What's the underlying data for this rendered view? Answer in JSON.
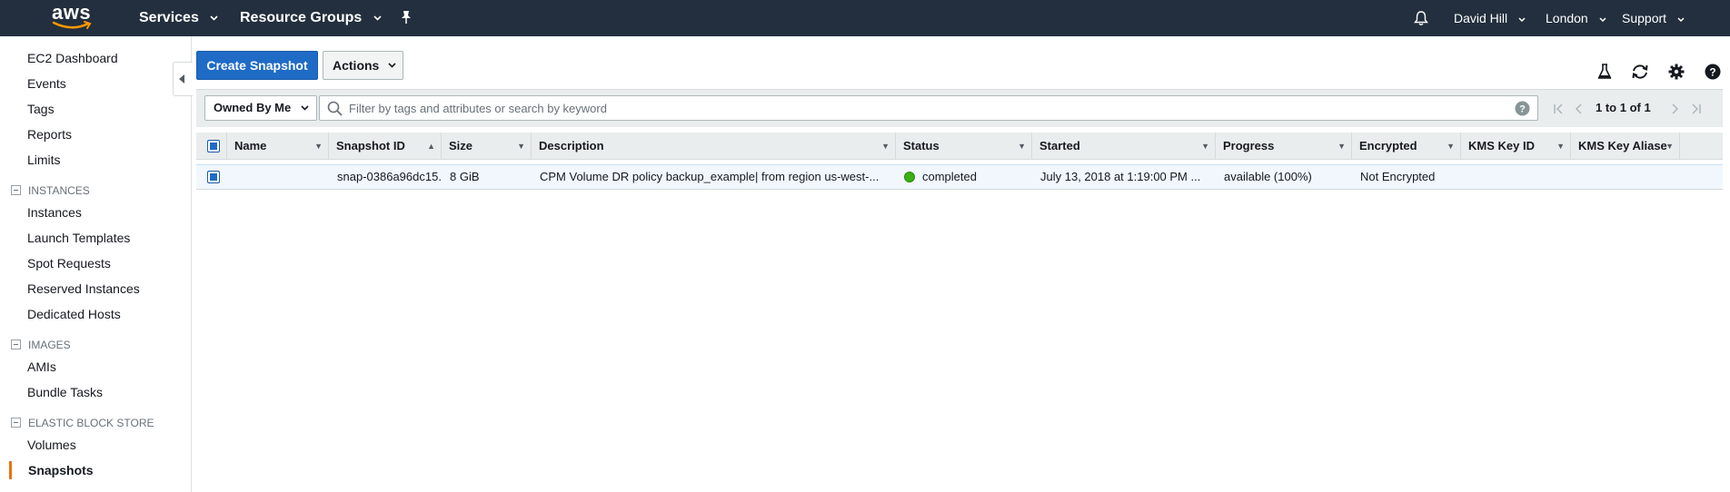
{
  "topnav": {
    "logo_text": "aws",
    "services_label": "Services",
    "resource_groups_label": "Resource Groups",
    "user_label": "David Hill",
    "region_label": "London",
    "support_label": "Support"
  },
  "sidebar": {
    "top_links": [
      {
        "label": "EC2 Dashboard"
      },
      {
        "label": "Events"
      },
      {
        "label": "Tags"
      },
      {
        "label": "Reports"
      },
      {
        "label": "Limits"
      }
    ],
    "instances_section": {
      "title": "INSTANCES",
      "items": [
        {
          "label": "Instances"
        },
        {
          "label": "Launch Templates"
        },
        {
          "label": "Spot Requests"
        },
        {
          "label": "Reserved Instances"
        },
        {
          "label": "Dedicated Hosts"
        }
      ]
    },
    "images_section": {
      "title": "IMAGES",
      "items": [
        {
          "label": "AMIs"
        },
        {
          "label": "Bundle Tasks"
        }
      ]
    },
    "ebs_section": {
      "title": "ELASTIC BLOCK STORE",
      "items": [
        {
          "label": "Volumes"
        },
        {
          "label": "Snapshots"
        }
      ]
    },
    "active_item": "Snapshots",
    "accent_color": "#ec7211"
  },
  "toolbar": {
    "create_label": "Create Snapshot",
    "actions_label": "Actions"
  },
  "filter": {
    "owned_label": "Owned By Me",
    "search_placeholder": "Filter by tags and attributes or search by keyword",
    "pager_text": "1 to 1 of 1"
  },
  "table": {
    "columns": [
      {
        "label": "Name"
      },
      {
        "label": "Snapshot ID"
      },
      {
        "label": "Size"
      },
      {
        "label": "Description"
      },
      {
        "label": "Status"
      },
      {
        "label": "Started"
      },
      {
        "label": "Progress"
      },
      {
        "label": "Encrypted"
      },
      {
        "label": "KMS Key ID"
      },
      {
        "label": "KMS Key Aliase"
      }
    ],
    "rows": [
      {
        "selected": true,
        "name": "",
        "snapshot_id": "snap-0386a96dc15...",
        "size": "8 GiB",
        "description": "CPM Volume DR policy backup_example| from region us-west-...",
        "status": "completed",
        "status_color": "#3cb010",
        "started": "July 13, 2018 at 1:19:00 PM ...",
        "progress": "available (100%)",
        "encrypted": "Not Encrypted",
        "kms_key_id": "",
        "kms_key_alias": ""
      }
    ]
  },
  "icons": [
    "bell-icon",
    "pin-icon",
    "flask-icon",
    "refresh-icon",
    "gear-icon",
    "help-icon",
    "search-icon",
    "first-page-icon",
    "prev-page-icon",
    "next-page-icon",
    "last-page-icon"
  ]
}
